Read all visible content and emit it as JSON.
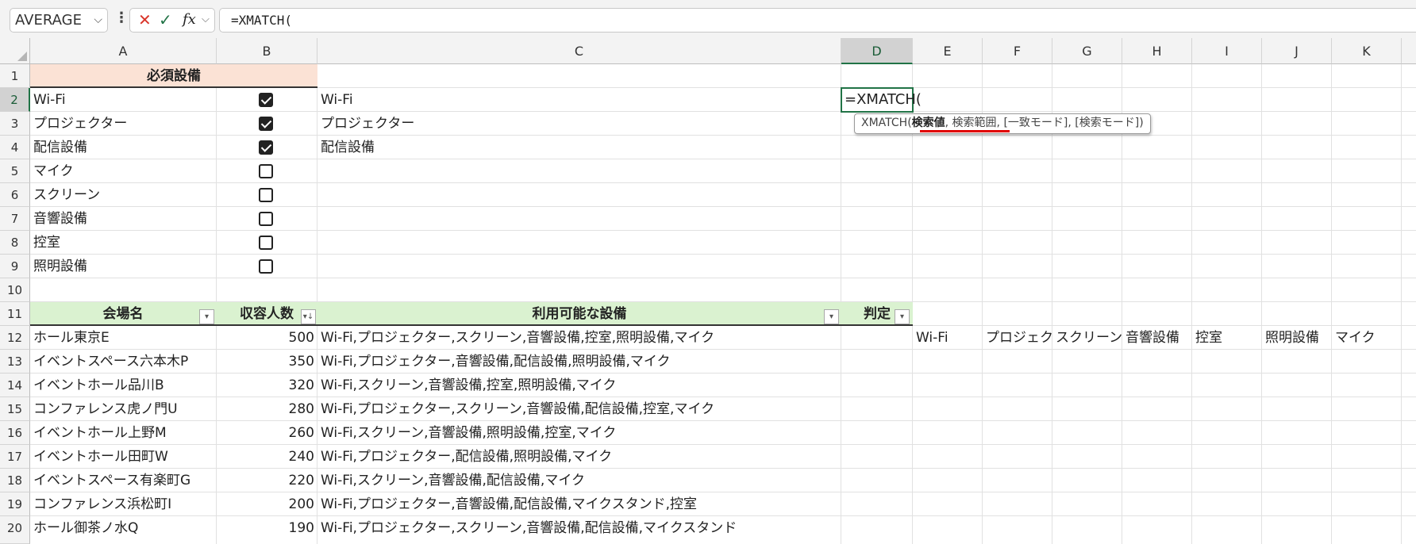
{
  "namebox": {
    "value": "AVERAGE"
  },
  "formula_bar": {
    "cancel_icon": "✕",
    "enter_icon": "✓",
    "fx_label": "fx",
    "formula": "=XMATCH("
  },
  "colors": {
    "accent": "#217346",
    "header_orange": "#fbe2d5",
    "header_green": "#daf2d0",
    "underline": "#e00000"
  },
  "columns": [
    "A",
    "B",
    "C",
    "D",
    "E",
    "F",
    "G",
    "H",
    "I",
    "J",
    "K"
  ],
  "rows": [
    "1",
    "2",
    "3",
    "4",
    "5",
    "6",
    "7",
    "8",
    "9",
    "10",
    "11",
    "12",
    "13",
    "14",
    "15",
    "16",
    "17",
    "18",
    "19",
    "20"
  ],
  "selected": {
    "column": "D",
    "row": "2"
  },
  "equipment": {
    "header": "必須設備",
    "items": [
      {
        "name": "Wi-Fi",
        "checked": true
      },
      {
        "name": "プロジェクター",
        "checked": true
      },
      {
        "name": "配信設備",
        "checked": true
      },
      {
        "name": "マイク",
        "checked": false
      },
      {
        "name": "スクリーン",
        "checked": false
      },
      {
        "name": "音響設備",
        "checked": false
      },
      {
        "name": "控室",
        "checked": false
      },
      {
        "name": "照明設備",
        "checked": false
      }
    ],
    "selected_list": [
      "Wi-Fi",
      "プロジェクター",
      "配信設備"
    ]
  },
  "active_cell": {
    "text": "=XMATCH("
  },
  "tooltip": {
    "fn": "XMATCH(",
    "arg1": "検索値",
    "rest": ", 検索範囲, [一致モード], [検索モード])"
  },
  "table": {
    "headers": {
      "name": "会場名",
      "capacity": "収容人数",
      "facilities": "利用可能な設備",
      "judge": "判定"
    },
    "rows": [
      {
        "name": "ホール東京E",
        "capacity": "500",
        "facilities": "Wi-Fi,プロジェクター,スクリーン,音響設備,控室,照明設備,マイク"
      },
      {
        "name": "イベントスペース六本木P",
        "capacity": "350",
        "facilities": "Wi-Fi,プロジェクター,音響設備,配信設備,照明設備,マイク"
      },
      {
        "name": "イベントホール品川B",
        "capacity": "320",
        "facilities": "Wi-Fi,スクリーン,音響設備,控室,照明設備,マイク"
      },
      {
        "name": "コンファレンス虎ノ門U",
        "capacity": "280",
        "facilities": "Wi-Fi,プロジェクター,スクリーン,音響設備,配信設備,控室,マイク"
      },
      {
        "name": "イベントホール上野M",
        "capacity": "260",
        "facilities": "Wi-Fi,スクリーン,音響設備,照明設備,控室,マイク"
      },
      {
        "name": "イベントホール田町W",
        "capacity": "240",
        "facilities": "Wi-Fi,プロジェクター,配信設備,照明設備,マイク"
      },
      {
        "name": "イベントスペース有楽町G",
        "capacity": "220",
        "facilities": "Wi-Fi,スクリーン,音響設備,配信設備,マイク"
      },
      {
        "name": "コンファレンス浜松町I",
        "capacity": "200",
        "facilities": "Wi-Fi,プロジェクター,音響設備,配信設備,マイクスタンド,控室"
      },
      {
        "name": "ホール御茶ノ水Q",
        "capacity": "190",
        "facilities": "Wi-Fi,プロジェクター,スクリーン,音響設備,配信設備,マイクスタンド"
      }
    ]
  },
  "row12_extra": [
    "Wi-Fi",
    "プロジェク",
    "スクリーン",
    "音響設備",
    "控室",
    "照明設備",
    "マイク"
  ]
}
